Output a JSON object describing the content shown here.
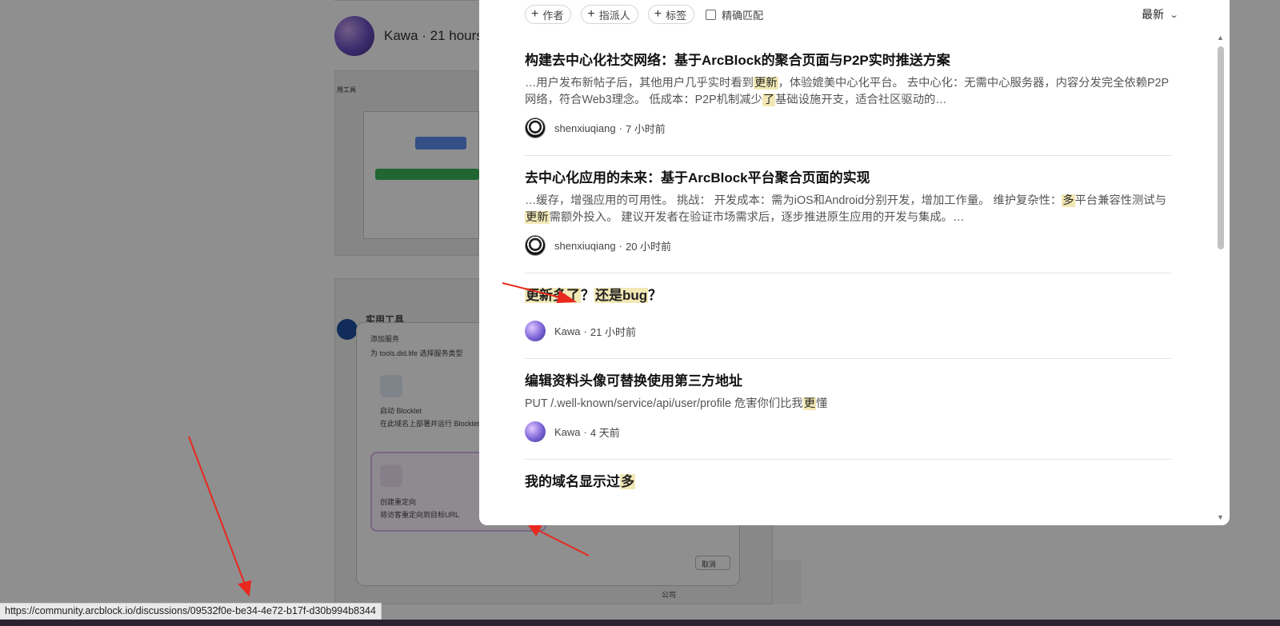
{
  "background": {
    "author": "Kawa · 21 hours",
    "shot1_label": "用工具",
    "shot2_labels": [
      "实用工具",
      "添加服务",
      "为 tools.did.life 选择服务类型",
      "启动 Blocklet",
      "在此域名上部署并运行 Blocklet 应用程",
      "创建重定向",
      "将访客重定向到目标URL",
      "取消",
      "公司"
    ]
  },
  "filters": {
    "chips": [
      {
        "label": "作者"
      },
      {
        "label": "指派人"
      },
      {
        "label": "标签"
      }
    ],
    "exact_match_label": "精确匹配",
    "sort_label": "最新"
  },
  "results": [
    {
      "title_parts": [
        {
          "t": "构建去中心化社交网络：基于ArcBlock的聚合页面与P2P实时推送方案",
          "h": false
        }
      ],
      "excerpt_parts": [
        {
          "t": "…用户发布新帖子后，其他用户几乎实时看到",
          "h": false
        },
        {
          "t": "更新",
          "h": true
        },
        {
          "t": "，体验媲美中心化平台。 去中心化：无需中心服务器，内容分发完全依赖P2P网络，符合Web3理念。 低成本：P2P机制减少",
          "h": false
        },
        {
          "t": "了",
          "h": true
        },
        {
          "t": "基础设施开支，适合社区驱动的…",
          "h": false
        }
      ],
      "author": "shenxiuqiang",
      "time": "7 小时前",
      "avatar": "dark"
    },
    {
      "title_parts": [
        {
          "t": "去中心化应用的未来：基于ArcBlock平台聚合页面的实现",
          "h": false
        }
      ],
      "excerpt_parts": [
        {
          "t": "…缓存，增强应用的可用性。 挑战： 开发成本：需为iOS和Android分别开发，增加工作量。 维护复杂性：",
          "h": false
        },
        {
          "t": "多",
          "h": true
        },
        {
          "t": "平台兼容性测试与",
          "h": false
        },
        {
          "t": "更新",
          "h": true
        },
        {
          "t": "需额外投入。 建议开发者在验证市场需求后，逐步推进原生应用的开发与集成。…",
          "h": false
        }
      ],
      "author": "shenxiuqiang",
      "time": "20 小时前",
      "avatar": "dark"
    },
    {
      "title_parts": [
        {
          "t": "更新多了",
          "h": true
        },
        {
          "t": "？",
          "h": false
        },
        {
          "t": "还是bug",
          "h": true
        },
        {
          "t": "？",
          "h": false
        }
      ],
      "excerpt_parts": [],
      "author": "Kawa",
      "time": "21 小时前",
      "avatar": "kawa"
    },
    {
      "title_parts": [
        {
          "t": "编辑资料头像可替换使用第三方地址",
          "h": false
        }
      ],
      "excerpt_parts": [
        {
          "t": "PUT /.well-known/service/api/user/profile 危害你们比我",
          "h": false
        },
        {
          "t": "更",
          "h": true
        },
        {
          "t": "懂",
          "h": false
        }
      ],
      "author": "Kawa",
      "time": "4 天前",
      "avatar": "kawa"
    },
    {
      "title_parts": [
        {
          "t": "我的域名显示过",
          "h": false
        },
        {
          "t": "多",
          "h": true
        }
      ],
      "excerpt_parts": [],
      "author": "",
      "time": "",
      "avatar": "none"
    }
  ],
  "status_url": "https://community.arcblock.io/discussions/09532f0e-be34-4e72-b17f-d30b994b8344",
  "colors": {
    "highlight": "#f2e8b5",
    "annotation_arrow": "#e8281e"
  }
}
